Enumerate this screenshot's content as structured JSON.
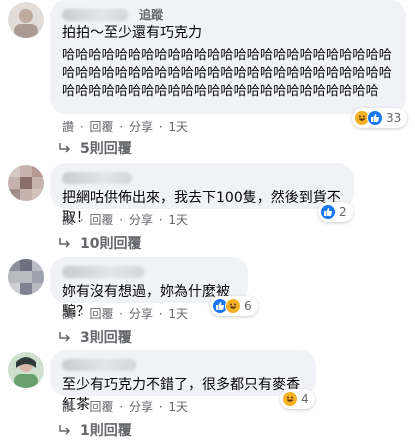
{
  "comments": [
    {
      "follow_label": "追蹤",
      "text": "拍拍～至少還有巧克力",
      "laugh_text": "哈哈哈哈哈哈哈哈哈哈哈哈哈哈哈哈哈哈哈哈哈哈哈哈哈哈哈哈哈哈哈哈哈哈哈哈哈哈哈哈哈哈哈哈哈哈哈哈哈哈哈哈哈哈哈哈哈哈哈哈哈哈哈哈哈哈哈哈哈哈哈哈哈哈",
      "actions": {
        "like": "讚",
        "reply": "回覆",
        "share": "分享",
        "time": "1天"
      },
      "reaction_count": "33",
      "reaction_icons": [
        "haha-icon",
        "like-icon"
      ],
      "replies_label": "5則回覆"
    },
    {
      "text": "把網咕供佈出來，我去下100隻，然後到貨不取！",
      "actions": {
        "like": "讚",
        "reply": "回覆",
        "share": "分享",
        "time": "1天"
      },
      "reaction_count": "2",
      "reaction_icons": [
        "like-icon"
      ],
      "replies_label": "10則回覆"
    },
    {
      "text": "妳有沒有想過，妳為什麼被騙？",
      "actions": {
        "like": "讚",
        "reply": "回覆",
        "share": "分享",
        "time": "1天"
      },
      "reaction_count": "6",
      "reaction_icons": [
        "like-icon",
        "haha-icon"
      ],
      "replies_label": "3則回覆"
    },
    {
      "text": "至少有巧克力不錯了，很多都只有麥香紅茶",
      "actions": {
        "like": "讚",
        "reply": "回覆",
        "share": "分享",
        "time": "1天"
      },
      "reaction_count": "4",
      "reaction_icons": [
        "haha-icon"
      ],
      "replies_label": "1則回覆"
    }
  ],
  "colors": {
    "bubble": "#f0f2f5",
    "meta": "#65676b",
    "like": "#1877f2",
    "haha": "#f7b125"
  }
}
